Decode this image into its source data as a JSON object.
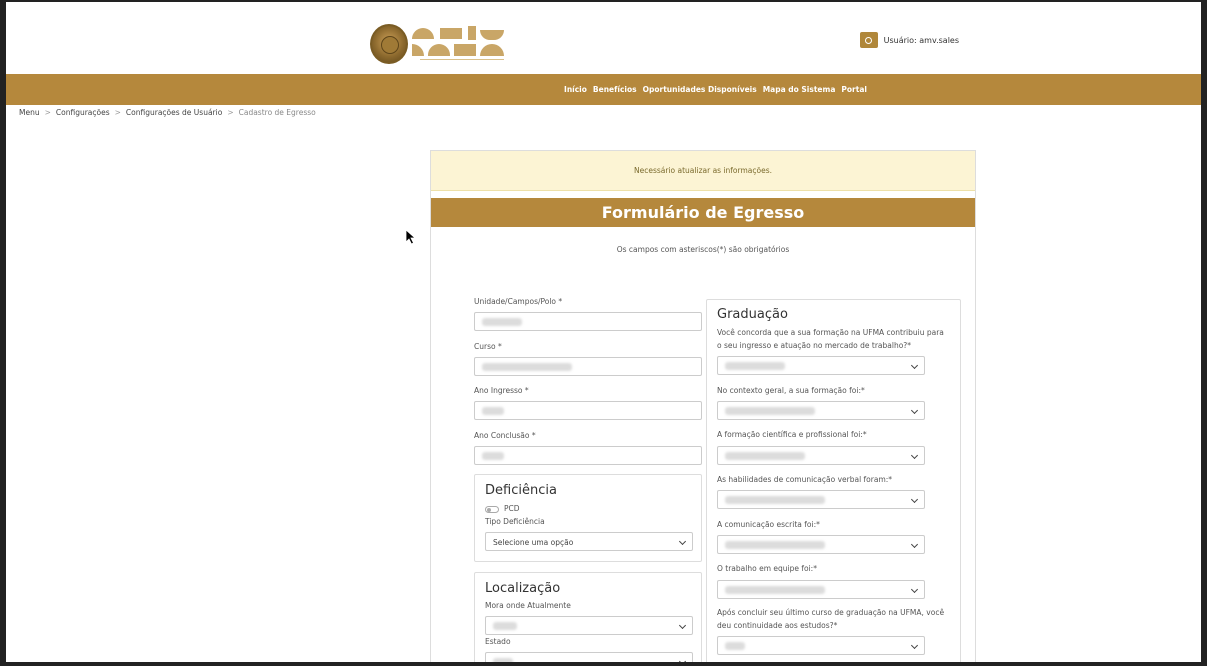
{
  "header": {
    "user_label": "Usuário: amv.sales"
  },
  "nav": {
    "items": [
      "Início",
      "Benefícios",
      "Oportunidades Disponíveis",
      "Mapa do Sistema",
      "Portal"
    ]
  },
  "breadcrumb": {
    "items": [
      "Menu",
      "Configurações",
      "Configurações de Usuário"
    ],
    "current": "Cadastro de Egresso",
    "separator": ">"
  },
  "alert": {
    "text": "Necessário atualizar as informações."
  },
  "form": {
    "title": "Formulário de Egresso",
    "required_note": "Os campos com asteriscos(*) são obrigatórios",
    "fields": {
      "unidade_label": "Unidade/Campos/Polo *",
      "curso_label": "Curso *",
      "ano_ingresso_label": "Ano Ingresso *",
      "ano_conclusao_label": "Ano Conclusão *"
    },
    "deficiencia": {
      "title": "Deficiência",
      "pcd_label": "PCD",
      "tipo_label": "Tipo Deficiência",
      "tipo_selected": "Selecione uma opção"
    },
    "localizacao": {
      "title": "Localização",
      "mora_label": "Mora onde Atualmente",
      "estado_label": "Estado"
    },
    "graduacao": {
      "title": "Graduação",
      "q1": "Você concorda que a sua formação na UFMA contribuiu para o seu ingresso e atuação no mercado de trabalho?*",
      "q2": "No contexto geral, a sua formação foi:*",
      "q3": "A formação científica e profissional foi:*",
      "q4": "As habilidades de comunicação verbal foram:*",
      "q5": "A comunicação escrita foi:*",
      "q6": "O trabalho em equipe foi:*",
      "q7": "Após concluir seu último curso de graduação na UFMA, você deu continuidade aos estudos?*"
    }
  },
  "colors": {
    "brand": "#b5883c",
    "alert_bg": "#fcf4d4"
  }
}
